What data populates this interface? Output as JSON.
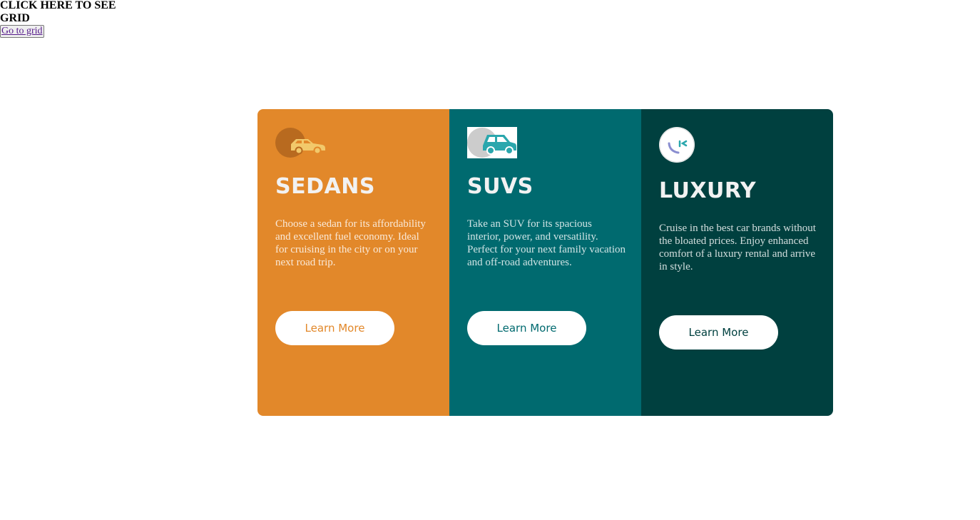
{
  "header": {
    "title": "CLICK HERE TO SEE GRID",
    "link_label": "Go to grid"
  },
  "cards": [
    {
      "icon": "sedan-car-icon",
      "title": "SEDANS",
      "text": "Choose a sedan for its affordability and excellent fuel economy. Ideal for cruising in the city or on your next road trip.",
      "button_label": "Learn More",
      "color": "#e2882a"
    },
    {
      "icon": "suv-car-icon",
      "title": "SUVS",
      "text": "Take an SUV for its spacious interior, power, and versatility. Perfect for your next family vacation and off-road adventures.",
      "button_label": "Learn More",
      "color": "#006a6f"
    },
    {
      "icon": "luxury-brand-icon",
      "title": "LUXURY",
      "text": "Cruise in the best car brands without the bloated prices. Enjoy enhanced comfort of a luxury rental and arrive in style.",
      "button_label": "Learn More",
      "color": "#00403f"
    }
  ]
}
